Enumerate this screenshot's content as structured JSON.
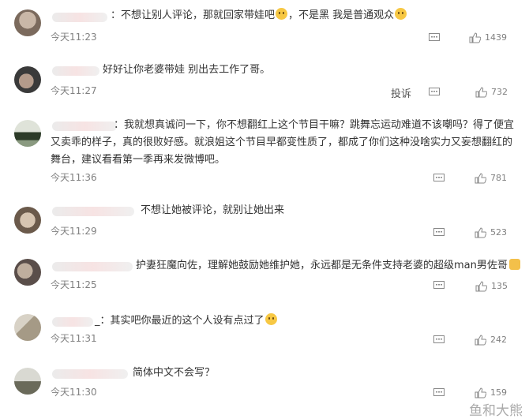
{
  "comments": [
    {
      "text": "：不想让别人评论，那就回家带娃吧",
      "text2": "，不是黑 我是普通观众",
      "time": "今天11:23",
      "likes": "1439"
    },
    {
      "text": "好好让你老婆带娃 别出去工作了哥。",
      "time": "今天11:27",
      "likes": "732",
      "report": "投诉"
    },
    {
      "text": "：我就想真诚问一下，你不想翻红上这个节目干嘛？跳舞忘运动难道不该嘲吗？得了便宜又卖乖的样子，真的很败好感。就浪姐这个节目早都变性质了，都成了你们这种没啥实力又妄想翻红的舞台，建议看看第一季再来发微博吧。",
      "time": "今天11:36",
      "likes": "781"
    },
    {
      "text": "不想让她被评论，就别让她出来",
      "time": "今天11:29",
      "likes": "523"
    },
    {
      "text": "护妻狂魔向佐，理解她鼓励她维护她，永远都是无条件支持老婆的超级man男佐哥",
      "time": "今天11:25",
      "likes": "135"
    },
    {
      "text": "_：其实吧你最近的这个人设有点过了",
      "time": "今天11:31",
      "likes": "242"
    },
    {
      "text": "简体中文不会写？",
      "time": "今天11:30",
      "likes": "159"
    }
  ],
  "watermark": "鱼和大熊",
  "icons": {
    "reply": "comment-icon",
    "like": "thumbs-up-icon"
  }
}
